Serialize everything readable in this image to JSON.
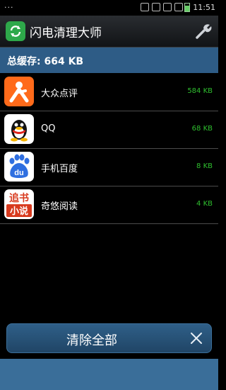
{
  "status_bar": {
    "time": "11:51",
    "dots": "···"
  },
  "header": {
    "title": "闪电清理大师"
  },
  "summary": {
    "total_cache": "总缓存: 664 KB"
  },
  "apps": [
    {
      "name": "大众点评",
      "size": "584 KB",
      "icon": "dianping-icon"
    },
    {
      "name": "QQ",
      "size": "68 KB",
      "icon": "qq-icon"
    },
    {
      "name": "手机百度",
      "size": "8 KB",
      "icon": "baidu-icon"
    },
    {
      "name": "奇悠阅读",
      "size": "4 KB",
      "icon": "zhuishu-icon"
    }
  ],
  "icon_texts": {
    "baidu": "du",
    "zhuishu_top": "追书",
    "zhuishu_bottom": "小说"
  },
  "actions": {
    "clear_all": "清除全部"
  },
  "colors": {
    "accent": "#2e5c86",
    "size_green": "#2fbf2f",
    "app_icon_green": "#2ea84a"
  }
}
